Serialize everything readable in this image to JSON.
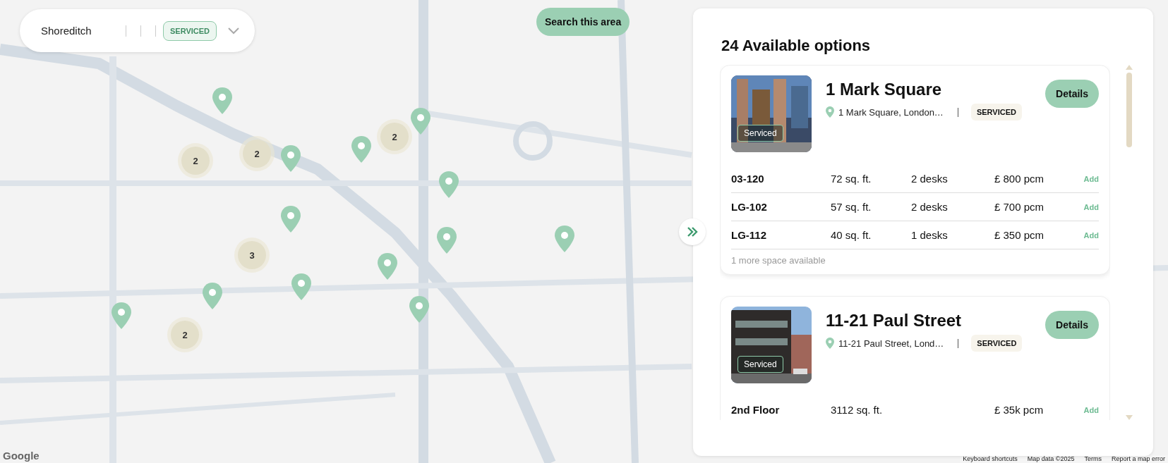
{
  "search": {
    "location": "Shoreditch",
    "filter_tag": "SERVICED"
  },
  "search_area_button": "Search this area",
  "map_markers": [
    {
      "kind": "pin"
    },
    {
      "kind": "pin"
    },
    {
      "kind": "pin"
    },
    {
      "kind": "pin"
    },
    {
      "kind": "pin"
    },
    {
      "kind": "pin"
    },
    {
      "kind": "pin"
    },
    {
      "kind": "pin"
    },
    {
      "kind": "pin"
    },
    {
      "kind": "pin"
    },
    {
      "kind": "pin"
    },
    {
      "kind": "pin"
    },
    {
      "kind": "pin"
    },
    {
      "kind": "cluster",
      "count": "2"
    },
    {
      "kind": "cluster",
      "count": "2"
    },
    {
      "kind": "cluster",
      "count": "2"
    },
    {
      "kind": "cluster",
      "count": "3"
    },
    {
      "kind": "cluster",
      "count": "2"
    }
  ],
  "panel": {
    "title": "24 Available options",
    "listings": [
      {
        "name": "1 Mark Square",
        "address": "1 Mark Square, London…",
        "tag": "SERVICED",
        "photo_badge": "Serviced",
        "button": "Details",
        "spaces": [
          {
            "unit": "03-120",
            "area": "72 sq. ft.",
            "desks": "2 desks",
            "price": "£ 800 pcm",
            "action": "Add"
          },
          {
            "unit": "LG-102",
            "area": "57 sq. ft.",
            "desks": "2 desks",
            "price": "£ 700 pcm",
            "action": "Add"
          },
          {
            "unit": "LG-112",
            "area": "40 sq. ft.",
            "desks": "1 desks",
            "price": "£ 350 pcm",
            "action": "Add"
          }
        ],
        "more": "1 more space available"
      },
      {
        "name": "11-21 Paul Street",
        "address": "11-21 Paul Street, Lond…",
        "tag": "SERVICED",
        "photo_badge": "Serviced",
        "button": "Details",
        "spaces": [
          {
            "unit": "2nd Floor",
            "area": "3112 sq. ft.",
            "price": "£ 35k pcm",
            "action": "Add"
          }
        ]
      }
    ]
  },
  "attribution": {
    "logo": "Google",
    "links": [
      "Keyboard shortcuts",
      "Map data ©2025",
      "Terms",
      "Report a map error"
    ]
  }
}
